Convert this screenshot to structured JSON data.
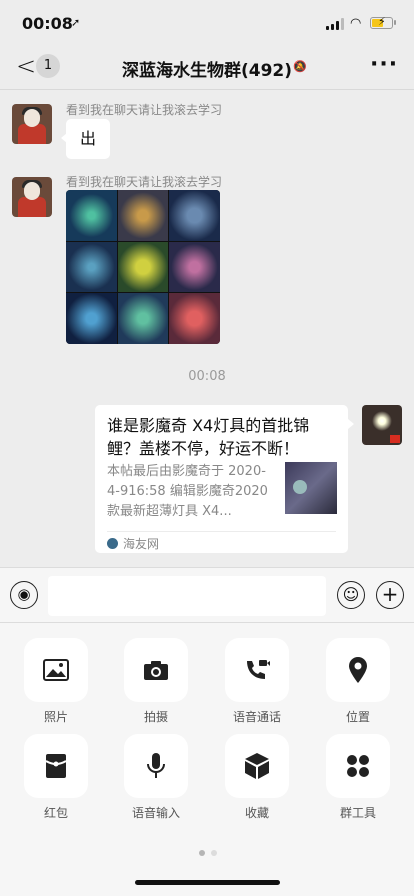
{
  "status_bar": {
    "time": "00:08",
    "location_icon": "location-arrow-icon",
    "signal_icon": "cellular-signal-icon",
    "wifi_icon": "wifi-icon",
    "battery_icon": "battery-charging-icon",
    "battery_level": 0.6
  },
  "nav": {
    "back_label": "<",
    "unread_count": "1",
    "title": "深蓝海水生物群(492)",
    "mute_icon": "bell-off-icon",
    "more_label": "···"
  },
  "messages": [
    {
      "sender": "看到我在聊天请让我滚去学习",
      "text": "出"
    },
    {
      "sender": "看到我在聊天请让我滚去学习",
      "image_icon": "coral-photo-grid"
    }
  ],
  "timestamp": "00:08",
  "link_card": {
    "title": "谁是影魔奇 X4灯具的首批锦鲤？盖楼不停，好运不断！",
    "description": "本帖最后由影魔奇于 2020-4-916:58 编辑影魔奇2020款最新超薄灯具 X4...",
    "source": "海友网"
  },
  "input_bar": {
    "voice_icon": "voice-icon",
    "placeholder": "",
    "emoji_icon": "emoji-icon",
    "plus_icon": "plus-icon"
  },
  "tools": [
    {
      "label": "照片",
      "icon": "photo-icon"
    },
    {
      "label": "拍摄",
      "icon": "camera-icon"
    },
    {
      "label": "语音通话",
      "icon": "voice-call-icon"
    },
    {
      "label": "位置",
      "icon": "location-icon"
    },
    {
      "label": "红包",
      "icon": "red-packet-icon"
    },
    {
      "label": "语音输入",
      "icon": "microphone-icon"
    },
    {
      "label": "收藏",
      "icon": "favorites-icon"
    },
    {
      "label": "群工具",
      "icon": "group-tools-icon"
    }
  ],
  "colors": {
    "background": "#ededed",
    "panel": "#f6f6f6",
    "bubble": "#ffffff",
    "muted_text": "#888888"
  }
}
